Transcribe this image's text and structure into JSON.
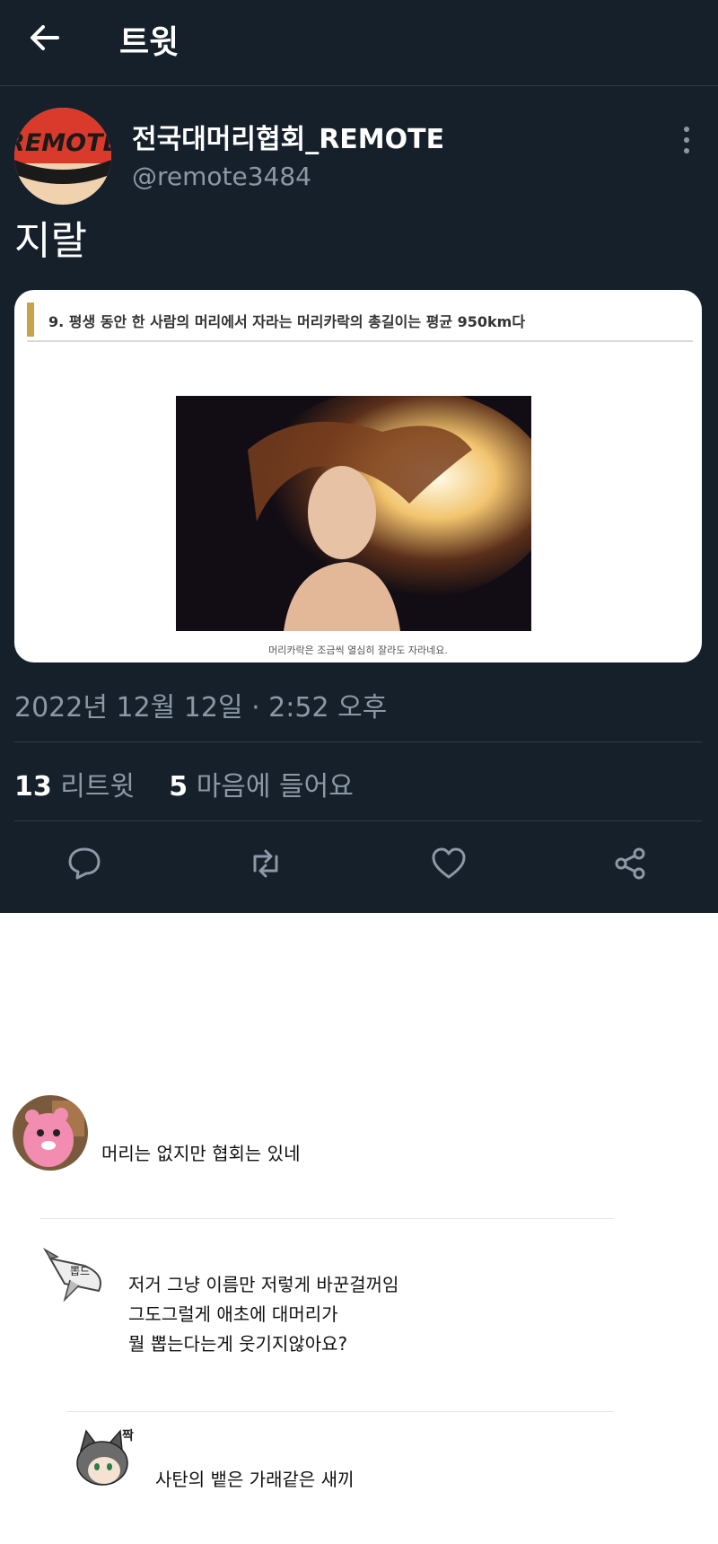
{
  "header": {
    "back_icon": "arrow-left-icon",
    "title": "트윗"
  },
  "tweet": {
    "author_name": "전국대머리협회_REMOTE",
    "author_handle": "@remote3484",
    "avatar_text": "REMOTE",
    "text": "지랄",
    "media": {
      "caption": "9. 평생 동안 한 사람의 머리에서 자라는 머리카락의 총길이는 평균 950km다",
      "photo_caption": "머리카락은 조금씩 열심히 잘라도 자라네요."
    },
    "timestamp": "2022년 12월 12일 · 2:52 오후",
    "retweets": {
      "count": "13",
      "label": "리트윗"
    },
    "likes": {
      "count": "5",
      "label": "마음에 들어요"
    },
    "actions": [
      "reply-icon",
      "retweet-icon",
      "like-icon",
      "share-icon"
    ]
  },
  "comments": [
    {
      "text": "머리는 없지만 협회는 있네"
    },
    {
      "lines": [
        "저거 그냥 이름만 저렇게 바꾼걸꺼임",
        "그도그럴게 애초에 대머리가",
        "뭘 뽑는다는게 웃기지않아요?"
      ],
      "avatar_text": "뽑드"
    },
    {
      "text": "사탄의 뱉은 가래같은 새끼",
      "avatar_text": "짝"
    }
  ],
  "colors": {
    "tweet_bg": "#15202b",
    "muted": "#8b98a5",
    "divider": "#2f3b47",
    "avatar_red": "#d93a2b"
  }
}
